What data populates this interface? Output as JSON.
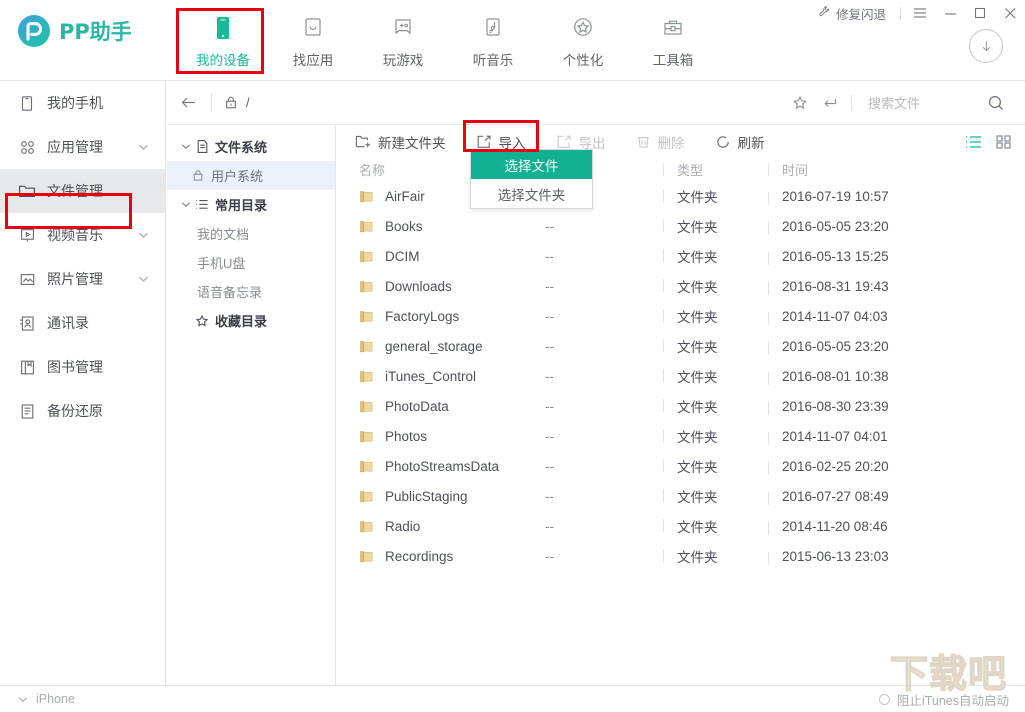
{
  "window": {
    "fix_crash_label": "修复闪退",
    "menu_icon": "hamburger-menu-icon",
    "minimize_icon": "minimize-icon",
    "maximize_icon": "maximize-icon",
    "close_icon": "close-icon"
  },
  "brand": {
    "name": "PP助手",
    "logo_icon": "pp-logo-icon",
    "accent_color": "#19b99a",
    "logo_gradient_from": "#3aa0e0",
    "logo_gradient_to": "#1dc3a0"
  },
  "nav_tabs": [
    {
      "label": "我的设备",
      "icon": "phone-icon",
      "active": true
    },
    {
      "label": "找应用",
      "icon": "app-bag-icon",
      "active": false
    },
    {
      "label": "玩游戏",
      "icon": "game-bag-icon",
      "active": false
    },
    {
      "label": "听音乐",
      "icon": "music-note-icon",
      "active": false
    },
    {
      "label": "个性化",
      "icon": "star-circle-icon",
      "active": false
    },
    {
      "label": "工具箱",
      "icon": "toolbox-icon",
      "active": false
    }
  ],
  "download_button": {
    "icon": "download-arrow-icon"
  },
  "sidebar": {
    "items": [
      {
        "label": "我的手机",
        "icon": "phone-outline-icon",
        "chevron": false,
        "selected": false
      },
      {
        "label": "应用管理",
        "icon": "apps-grid-icon",
        "chevron": true,
        "selected": false
      },
      {
        "label": "文件管理",
        "icon": "folder-icon",
        "chevron": false,
        "selected": true
      },
      {
        "label": "视频音乐",
        "icon": "video-play-icon",
        "chevron": true,
        "selected": false
      },
      {
        "label": "照片管理",
        "icon": "photo-mountain-icon",
        "chevron": true,
        "selected": false
      },
      {
        "label": "通讯录",
        "icon": "contacts-icon",
        "chevron": false,
        "selected": false
      },
      {
        "label": "图书管理",
        "icon": "book-icon",
        "chevron": false,
        "selected": false
      },
      {
        "label": "备份还原",
        "icon": "backup-restore-icon",
        "chevron": false,
        "selected": false
      }
    ]
  },
  "tree": {
    "nodes": [
      {
        "label": "文件系统",
        "type": "root",
        "icon": "document-icon",
        "expanded": true,
        "selected": false
      },
      {
        "label": "用户系统",
        "type": "child",
        "icon": "lock-icon",
        "expanded": false,
        "selected": true
      },
      {
        "label": "常用目录",
        "type": "root",
        "icon": "list-icon",
        "expanded": true,
        "selected": false
      },
      {
        "label": "我的文档",
        "type": "child",
        "icon": "",
        "expanded": false,
        "selected": false
      },
      {
        "label": "手机U盘",
        "type": "child",
        "icon": "",
        "expanded": false,
        "selected": false
      },
      {
        "label": "语音备忘录",
        "type": "child",
        "icon": "",
        "expanded": false,
        "selected": false
      },
      {
        "label": "收藏目录",
        "type": "root",
        "icon": "star-icon",
        "expanded": false,
        "selected": false,
        "nochevron": true
      }
    ]
  },
  "pathbar": {
    "back_icon": "back-arrow-icon",
    "lock_icon": "lock-icon",
    "path": "/",
    "star_icon": "star-icon",
    "enter_icon": "enter-arrow-icon",
    "search_placeholder": "搜索文件",
    "search_value": "",
    "search_icon": "search-icon"
  },
  "toolbar": {
    "new_folder_label": "新建文件夹",
    "new_folder_icon": "new-folder-icon",
    "import_label": "导入",
    "import_icon": "import-icon",
    "export_label": "导出",
    "export_icon": "export-icon",
    "export_disabled": true,
    "delete_label": "删除",
    "delete_icon": "trash-icon",
    "delete_disabled": true,
    "refresh_label": "刷新",
    "refresh_icon": "refresh-icon",
    "view_list_icon": "list-view-icon",
    "view_grid_icon": "grid-view-icon",
    "view_active": "list"
  },
  "import_dropdown": {
    "open": true,
    "items": [
      {
        "label": "选择文件",
        "highlighted": true
      },
      {
        "label": "选择文件夹",
        "highlighted": false
      }
    ]
  },
  "file_list": {
    "columns": [
      "名称",
      "",
      "类型",
      "时间"
    ],
    "rows": [
      {
        "name": "AirFair",
        "size": "--",
        "type": "文件夹",
        "time": "2016-07-19 10:57",
        "icon": "folder-icon"
      },
      {
        "name": "Books",
        "size": "--",
        "type": "文件夹",
        "time": "2016-05-05 23:20",
        "icon": "folder-icon"
      },
      {
        "name": "DCIM",
        "size": "--",
        "type": "文件夹",
        "time": "2016-05-13 15:25",
        "icon": "folder-icon"
      },
      {
        "name": "Downloads",
        "size": "--",
        "type": "文件夹",
        "time": "2016-08-31 19:43",
        "icon": "folder-icon"
      },
      {
        "name": "FactoryLogs",
        "size": "--",
        "type": "文件夹",
        "time": "2014-11-07 04:03",
        "icon": "folder-icon"
      },
      {
        "name": "general_storage",
        "size": "--",
        "type": "文件夹",
        "time": "2016-05-05 23:20",
        "icon": "folder-icon"
      },
      {
        "name": "iTunes_Control",
        "size": "--",
        "type": "文件夹",
        "time": "2016-08-01 10:38",
        "icon": "folder-icon"
      },
      {
        "name": "PhotoData",
        "size": "--",
        "type": "文件夹",
        "time": "2016-08-30 23:39",
        "icon": "folder-icon"
      },
      {
        "name": "Photos",
        "size": "--",
        "type": "文件夹",
        "time": "2014-11-07 04:01",
        "icon": "folder-icon"
      },
      {
        "name": "PhotoStreamsData",
        "size": "--",
        "type": "文件夹",
        "time": "2016-02-25 20:20",
        "icon": "folder-icon"
      },
      {
        "name": "PublicStaging",
        "size": "--",
        "type": "文件夹",
        "time": "2016-07-27 08:49",
        "icon": "folder-icon"
      },
      {
        "name": "Radio",
        "size": "--",
        "type": "文件夹",
        "time": "2014-11-20 08:46",
        "icon": "folder-icon"
      },
      {
        "name": "Recordings",
        "size": "--",
        "type": "文件夹",
        "time": "2015-06-13 23:03",
        "icon": "folder-icon"
      }
    ]
  },
  "statusbar": {
    "device_label": "iPhone",
    "device_chevron_icon": "chevron-down-icon",
    "itunes_label": "阻止iTunes自动启动",
    "itunes_radio_icon": "radio-circle-icon"
  },
  "watermark": {
    "text": "下载吧"
  }
}
